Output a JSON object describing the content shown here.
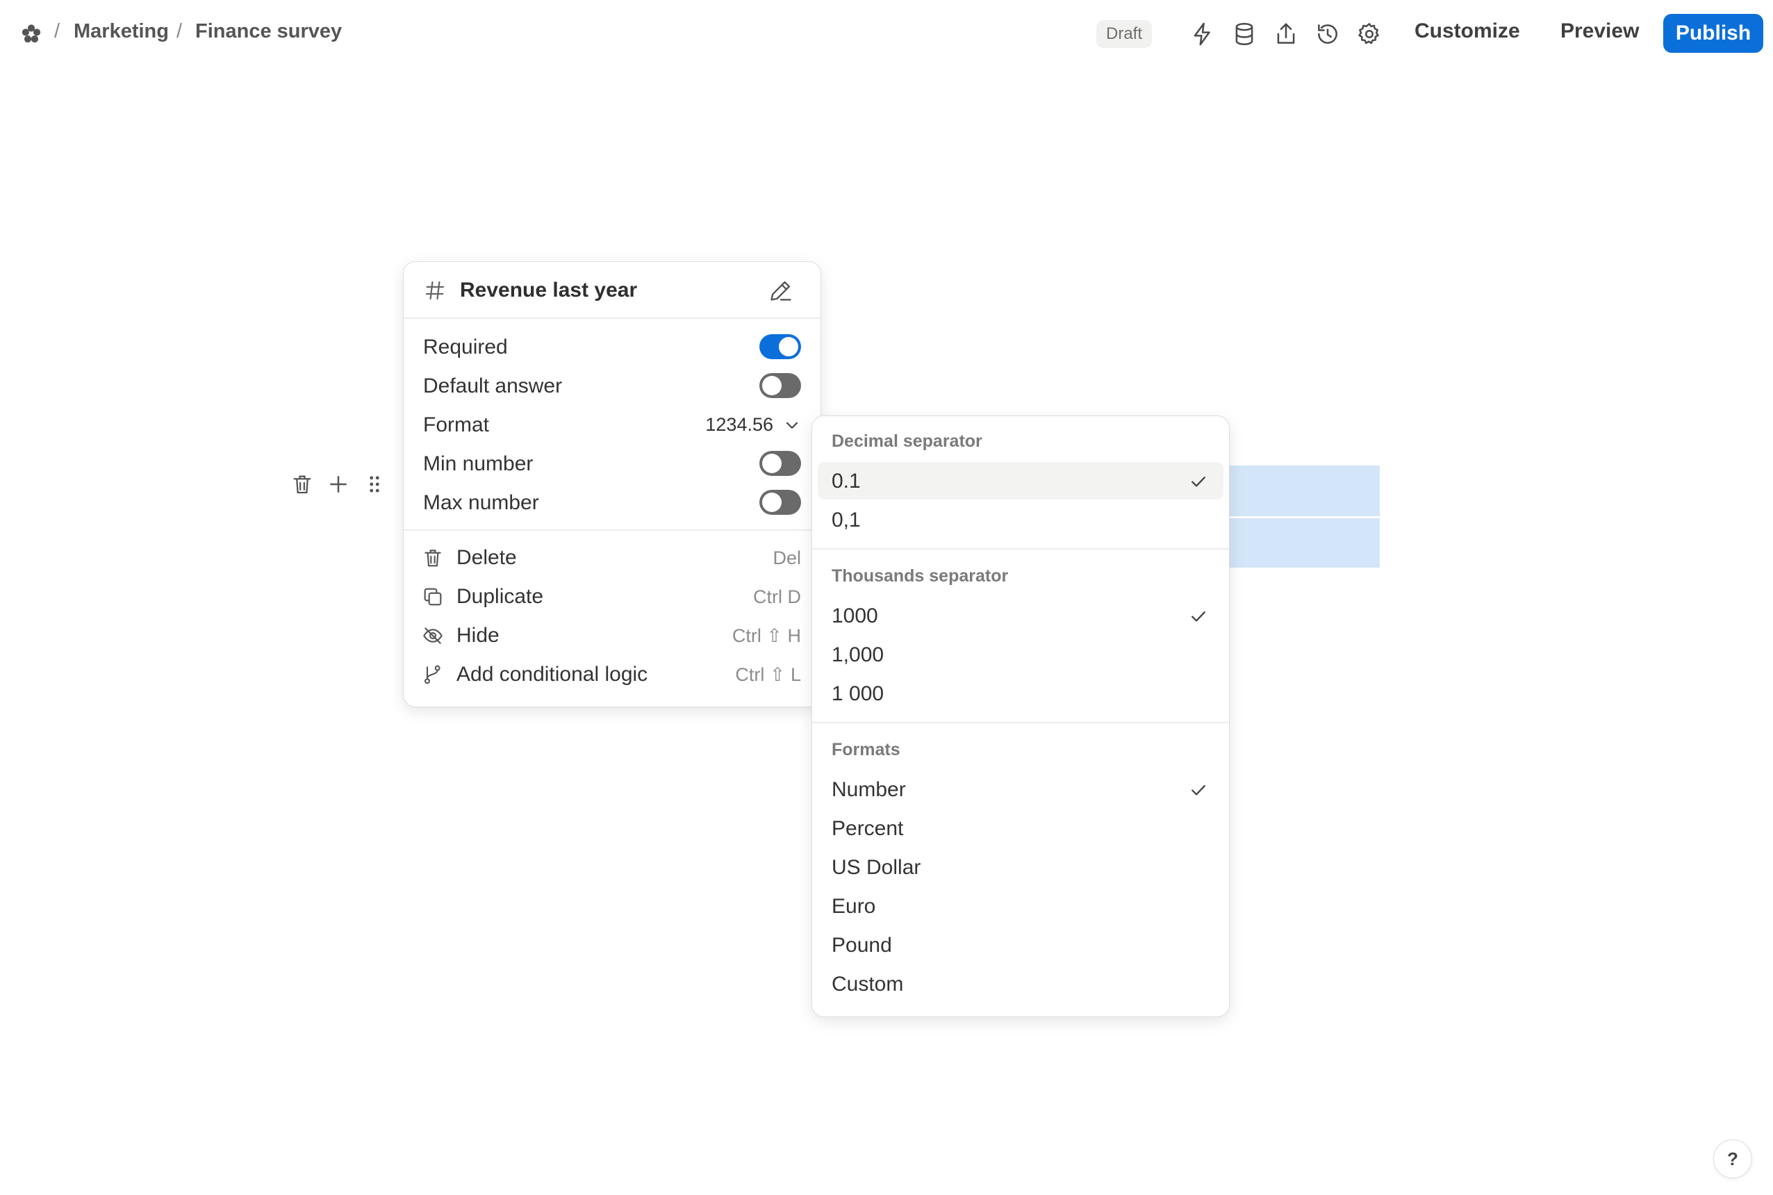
{
  "breadcrumb": {
    "logo_icon": "flower-logo-icon",
    "separator": "/",
    "items": [
      "Marketing",
      "Finance survey"
    ]
  },
  "header": {
    "status_badge": "Draft",
    "icons": [
      "bolt-icon",
      "database-icon",
      "share-icon",
      "history-icon",
      "gear-icon"
    ],
    "customize_label": "Customize",
    "preview_label": "Preview",
    "publish_label": "Publish",
    "accent_color": "#0b6fda"
  },
  "field_menu": {
    "type_icon": "hash-icon",
    "title": "Revenue last year",
    "edit_icon": "pencil-icon",
    "settings": [
      {
        "label": "Required",
        "enabled": true
      },
      {
        "label": "Default answer",
        "enabled": false
      }
    ],
    "format": {
      "label": "Format",
      "value": "1234.56"
    },
    "limits": [
      {
        "label": "Min number",
        "enabled": false
      },
      {
        "label": "Max number",
        "enabled": false
      }
    ],
    "actions": [
      {
        "label": "Delete",
        "shortcut": "Del",
        "icon": "trash-icon"
      },
      {
        "label": "Duplicate",
        "shortcut": "Ctrl D",
        "icon": "duplicate-icon"
      },
      {
        "label": "Hide",
        "shortcut": "Ctrl ⇧ H",
        "icon": "eye-off-icon"
      },
      {
        "label": "Add conditional logic",
        "shortcut": "Ctrl ⇧ L",
        "icon": "branch-icon"
      }
    ]
  },
  "format_dropdown": {
    "decimal": {
      "heading": "Decimal separator",
      "options": [
        {
          "label": "0.1",
          "selected": true
        },
        {
          "label": "0,1",
          "selected": false
        }
      ]
    },
    "thousands": {
      "heading": "Thousands separator",
      "options": [
        {
          "label": "1000",
          "selected": true
        },
        {
          "label": "1,000",
          "selected": false
        },
        {
          "label": "1 000",
          "selected": false
        }
      ]
    },
    "formats": {
      "heading": "Formats",
      "options": [
        {
          "label": "Number",
          "selected": true
        },
        {
          "label": "Percent",
          "selected": false
        },
        {
          "label": "US Dollar",
          "selected": false
        },
        {
          "label": "Euro",
          "selected": false
        },
        {
          "label": "Pound",
          "selected": false
        },
        {
          "label": "Custom",
          "selected": false
        }
      ]
    }
  },
  "row_tools": [
    "trash-icon",
    "plus-icon",
    "drag-handle-icon"
  ],
  "help_label": "?"
}
